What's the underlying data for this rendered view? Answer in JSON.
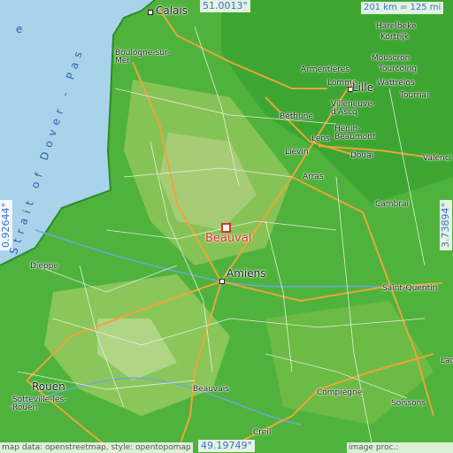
{
  "coordinates": {
    "top_lat": "51.0013°",
    "bottom_lat": "49.19749°",
    "left_lon": "0.92644°",
    "right_lon": "3.73894°"
  },
  "scale": "201 km = 125 mi",
  "sea_label": "Strait of Dover - Pas",
  "sea_label_extra": "e",
  "target": {
    "name": "Beauval"
  },
  "places": {
    "calais": "Calais",
    "boulogne": "Boulogne-sur-\nMer",
    "harelbeke": "Harelbeke",
    "kortrijk": "Kortrijk",
    "mouscron": "Mouscron",
    "tourcoing": "Tourcoing",
    "armentieres": "Armentières",
    "lomme": "Lomme",
    "lille": "Lille",
    "wattrelos": "Wattrelos",
    "tournai": "Tournai",
    "villeneuve": "Villeneuve-\nd'Ascq",
    "bethune": "Béthune",
    "henin": "Hénin-\nBeaumont",
    "lens": "Lens",
    "lievin": "Liévin",
    "douai": "Douai",
    "valenciennes": "Valenci",
    "arras": "Arras",
    "cambrai": "Cambrai",
    "amiens": "Amiens",
    "saint_quentin": "Saint-Quentin",
    "dieppe": "Dieppe",
    "rouen": "Rouen",
    "sotteville": "Sotteville-lès-\nRouen",
    "beauvais": "Beauvais",
    "compiegne": "Compiègne",
    "soissons": "Soissons",
    "laon": "Lao",
    "creil": "Creil"
  },
  "footer": {
    "left": "map data: openstreetmap, style: opentopomap",
    "right": "image proc.: elevation.city"
  },
  "colors": {
    "sea": "#a9d3ea",
    "lowland": "#4fb23c",
    "midland": "#7bc64a",
    "upland": "#a7cf74",
    "road_major": "#e9a63c",
    "road_minor": "#f5f5f0",
    "marker": "#e0302a"
  }
}
